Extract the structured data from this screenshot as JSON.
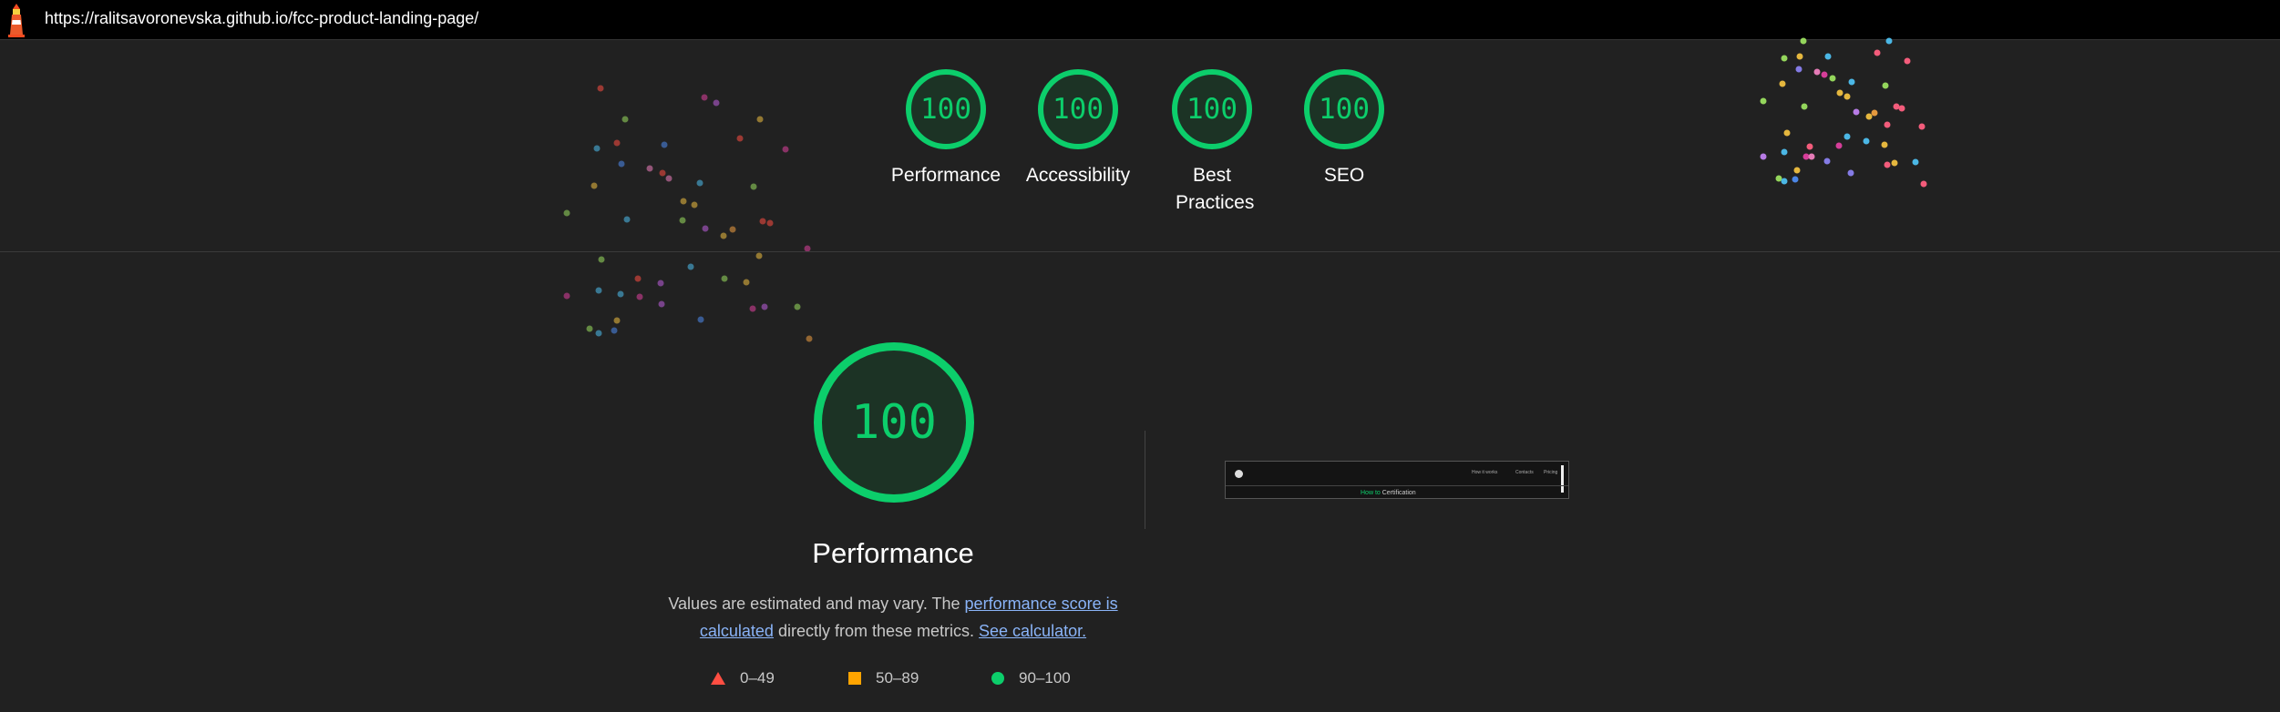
{
  "topbar": {
    "url": "https://ralitsavoronevska.github.io/fcc-product-landing-page/",
    "logo_icon": "lighthouse-icon"
  },
  "score_gauges": [
    {
      "score": "100",
      "label": "Performance"
    },
    {
      "score": "100",
      "label": "Accessibility"
    },
    {
      "score": "100",
      "label": "Best Practices"
    },
    {
      "score": "100",
      "label": "SEO"
    }
  ],
  "performance": {
    "score": "100",
    "title": "Performance",
    "desc_text_1": "Values are estimated and may vary. The ",
    "desc_link_1": "performance score is calculated",
    "desc_text_2": " directly from these metrics. ",
    "desc_link_2": "See calculator."
  },
  "legend": [
    {
      "icon": "fail-triangle-icon",
      "range": "0–49",
      "color": "#ff4e42"
    },
    {
      "icon": "average-square-icon",
      "range": "50–89",
      "color": "#ffa400"
    },
    {
      "icon": "pass-circle-icon",
      "range": "90–100",
      "color": "#0cce6b"
    }
  ],
  "thumbnail": {
    "nav_items": [
      "How it works",
      "Contacts",
      "Pricing"
    ],
    "heading_highlight": "How to",
    "heading_rest": " Certification"
  },
  "colors": {
    "pass": "#0cce6b",
    "background": "#212121",
    "link": "#8ab4f8"
  }
}
